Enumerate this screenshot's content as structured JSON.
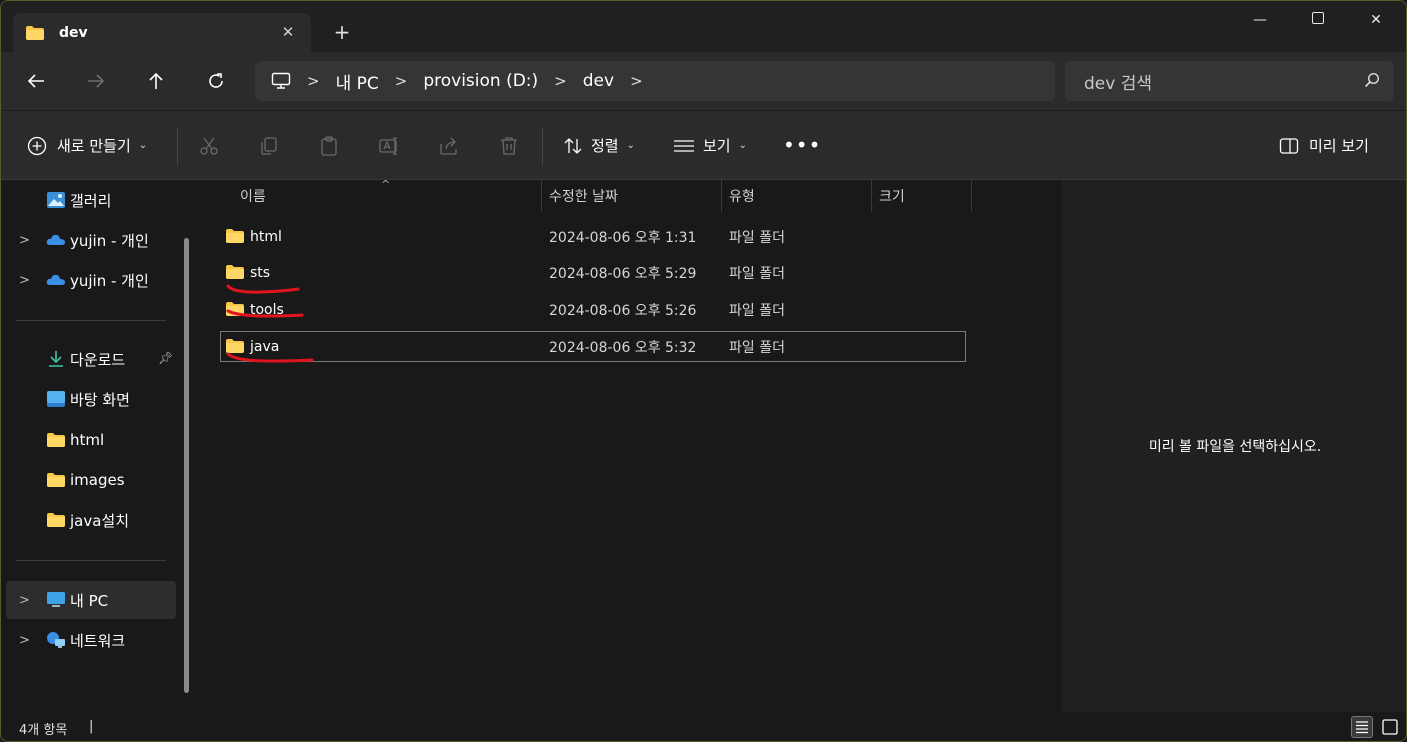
{
  "window": {
    "tab_title": "dev",
    "close_tab": "✕",
    "new_tab": "+",
    "minimize": "—",
    "maximize": "☐",
    "close": "✕"
  },
  "address": {
    "breadcrumbs": [
      "내 PC",
      "provision (D:)",
      "dev"
    ],
    "search_placeholder": "dev 검색"
  },
  "toolbar": {
    "new_label": "새로 만들기",
    "sort_label": "정렬",
    "view_label": "보기",
    "more_label": "•••",
    "preview_label": "미리 보기"
  },
  "sidebar": {
    "items": [
      {
        "label": "갤러리",
        "icon": "gallery-icon"
      },
      {
        "label": "yujin - 개인",
        "icon": "onedrive-icon"
      },
      {
        "label": "yujin - 개인",
        "icon": "onedrive-icon"
      },
      {
        "label": "다운로드",
        "icon": "download-icon",
        "pinned": true
      },
      {
        "label": "바탕 화면",
        "icon": "desktop-icon"
      },
      {
        "label": "html",
        "icon": "folder-icon"
      },
      {
        "label": "images",
        "icon": "folder-icon"
      },
      {
        "label": "java설치",
        "icon": "folder-icon"
      },
      {
        "label": "내 PC",
        "icon": "pc-icon"
      },
      {
        "label": "네트워크",
        "icon": "network-icon"
      }
    ]
  },
  "columns": {
    "name": "이름",
    "date": "수정한 날짜",
    "type": "유형",
    "size": "크기"
  },
  "files": [
    {
      "name": "html",
      "date": "2024-08-06 오후 1:31",
      "type": "파일 폴더"
    },
    {
      "name": "sts",
      "date": "2024-08-06 오후 5:29",
      "type": "파일 폴더"
    },
    {
      "name": "tools",
      "date": "2024-08-06 오후 5:26",
      "type": "파일 폴더"
    },
    {
      "name": "java",
      "date": "2024-08-06 오후 5:32",
      "type": "파일 폴더"
    }
  ],
  "preview": {
    "message": "미리 볼 파일을 선택하십시오."
  },
  "status": {
    "item_count": "4개 항목",
    "separator": "|"
  },
  "colors": {
    "folder": "#f8c74a",
    "annotation": "#e0141e",
    "onedrive": "#3a8ee6"
  }
}
